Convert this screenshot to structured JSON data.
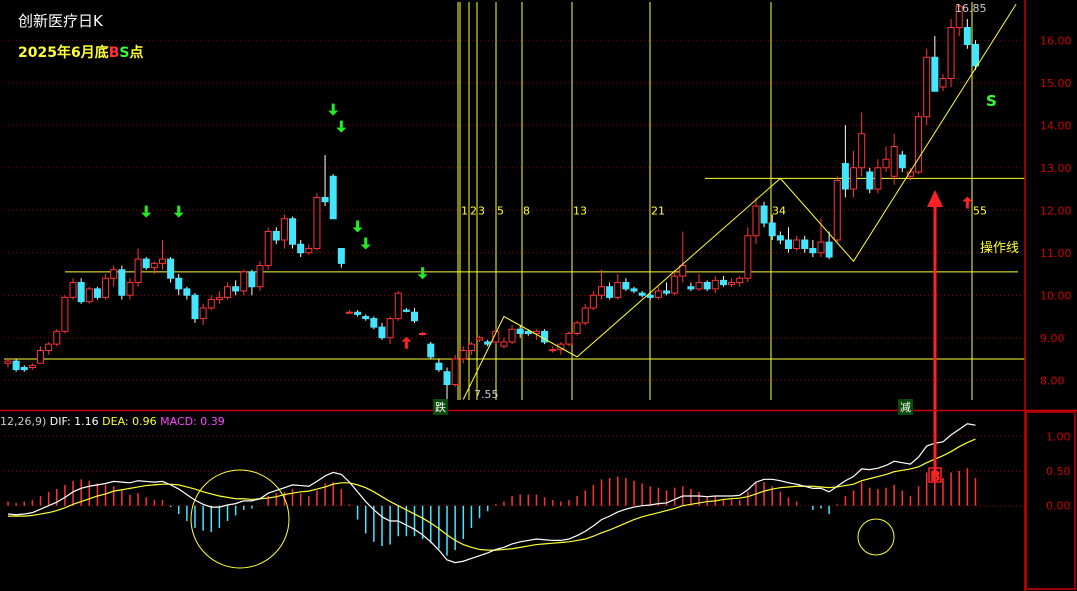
{
  "title": "创新医疗日K",
  "subtitle": {
    "prefix": "2025年6月底",
    "b": "B",
    "s": "S",
    "suffix": "点"
  },
  "macd_header": {
    "params": "12,26,9)",
    "dif": "DIF: 1.16",
    "dea": "DEA: 0.96",
    "macd": "MACD: 0.39"
  },
  "labels": {
    "high": "16.85",
    "low": "7.55",
    "operation_line": "操作线",
    "sell_marker": "S",
    "buy_marker": "B",
    "box_left": "跌",
    "box_right": "减"
  },
  "fib_numbers": [
    "1",
    "2",
    "3",
    "5",
    "8",
    "13",
    "21",
    "34",
    "55"
  ],
  "colors": {
    "up": "#ff3333",
    "down": "#44e6ff",
    "yellow": "#ffff33",
    "grid": "#990000",
    "axis": "#cc0000",
    "arrow_green": "#22ee22",
    "arrow_red": "#ff2222"
  },
  "chart_data": [
    {
      "type": "candlestick",
      "title": "创新医疗日K",
      "ylim": [
        7.3,
        16.9
      ],
      "yticks": [
        8.0,
        9.0,
        10.0,
        11.0,
        12.0,
        13.0,
        14.0,
        15.0,
        16.0
      ],
      "ytick_labels": [
        "8.00",
        "9.00",
        "10.00",
        "11.00",
        "12.00",
        "13.00",
        "14.00",
        "15.00",
        "16.00"
      ],
      "horizontal_lines": [
        8.5,
        10.55,
        12.75
      ],
      "candles": [
        [
          8.4,
          8.5,
          8.3,
          8.45
        ],
        [
          8.45,
          8.5,
          8.2,
          8.25
        ],
        [
          8.3,
          8.35,
          8.2,
          8.25
        ],
        [
          8.3,
          8.4,
          8.25,
          8.35
        ],
        [
          8.4,
          8.8,
          8.4,
          8.7
        ],
        [
          8.7,
          8.9,
          8.6,
          8.85
        ],
        [
          8.85,
          9.2,
          8.8,
          9.15
        ],
        [
          9.15,
          10.0,
          9.1,
          9.95
        ],
        [
          9.95,
          10.4,
          9.9,
          10.3
        ],
        [
          10.3,
          10.4,
          9.8,
          9.85
        ],
        [
          9.85,
          10.2,
          9.8,
          10.15
        ],
        [
          10.15,
          10.2,
          9.9,
          9.95
        ],
        [
          9.95,
          10.5,
          9.9,
          10.4
        ],
        [
          10.4,
          10.7,
          10.2,
          10.6
        ],
        [
          10.6,
          10.7,
          9.9,
          10.0
        ],
        [
          10.0,
          10.4,
          9.9,
          10.3
        ],
        [
          10.3,
          11.1,
          10.2,
          10.85
        ],
        [
          10.85,
          10.9,
          10.6,
          10.65
        ],
        [
          10.65,
          10.8,
          10.5,
          10.75
        ],
        [
          10.75,
          11.3,
          10.6,
          10.85
        ],
        [
          10.85,
          10.9,
          10.3,
          10.4
        ],
        [
          10.4,
          10.5,
          10.0,
          10.15
        ],
        [
          10.15,
          10.2,
          9.9,
          10.0
        ],
        [
          10.0,
          10.05,
          9.35,
          9.45
        ],
        [
          9.45,
          9.8,
          9.3,
          9.7
        ],
        [
          9.7,
          10.0,
          9.65,
          9.9
        ],
        [
          9.9,
          10.1,
          9.8,
          9.95
        ],
        [
          9.95,
          10.3,
          9.9,
          10.2
        ],
        [
          10.2,
          10.35,
          10.0,
          10.1
        ],
        [
          10.1,
          10.6,
          10.0,
          10.55
        ],
        [
          10.55,
          10.6,
          10.0,
          10.2
        ],
        [
          10.2,
          10.8,
          10.1,
          10.7
        ],
        [
          10.7,
          11.6,
          10.6,
          11.5
        ],
        [
          11.5,
          11.6,
          11.2,
          11.3
        ],
        [
          11.3,
          11.9,
          11.1,
          11.8
        ],
        [
          11.8,
          11.85,
          11.1,
          11.2
        ],
        [
          11.2,
          11.3,
          10.9,
          11.0
        ],
        [
          11.0,
          11.2,
          10.95,
          11.1
        ],
        [
          11.1,
          12.4,
          11.05,
          12.3
        ],
        [
          12.3,
          13.3,
          12.1,
          12.2
        ],
        [
          12.8,
          12.85,
          11.9,
          11.8
        ],
        [
          11.1,
          11.1,
          10.65,
          10.75
        ],
        [
          9.6,
          9.65,
          9.6,
          9.6
        ],
        [
          9.6,
          9.65,
          9.5,
          9.55
        ],
        [
          9.5,
          9.55,
          9.4,
          9.45
        ],
        [
          9.45,
          9.5,
          9.2,
          9.25
        ],
        [
          9.25,
          9.35,
          8.95,
          9.0
        ],
        [
          9.0,
          9.5,
          8.85,
          9.45
        ],
        [
          9.45,
          10.1,
          9.4,
          10.05
        ],
        [
          9.65,
          9.7,
          9.6,
          9.62
        ],
        [
          9.6,
          9.7,
          9.35,
          9.4
        ],
        [
          9.1,
          9.15,
          9.05,
          9.1
        ],
        [
          8.85,
          8.9,
          8.5,
          8.55
        ],
        [
          8.4,
          8.5,
          8.2,
          8.25
        ],
        [
          8.2,
          8.3,
          7.55,
          7.9
        ],
        [
          7.9,
          8.6,
          7.85,
          8.5
        ],
        [
          8.5,
          8.8,
          8.4,
          8.7
        ],
        [
          8.7,
          8.9,
          8.6,
          8.85
        ],
        [
          8.95,
          9.05,
          8.9,
          9.0
        ],
        [
          8.9,
          8.95,
          8.8,
          8.85
        ],
        [
          8.9,
          9.2,
          8.85,
          9.15
        ],
        [
          8.8,
          9.0,
          8.75,
          8.9
        ],
        [
          8.9,
          9.3,
          8.85,
          9.2
        ],
        [
          9.2,
          9.3,
          9.0,
          9.1
        ],
        [
          9.15,
          9.2,
          9.05,
          9.1
        ],
        [
          9.1,
          9.2,
          8.95,
          9.15
        ],
        [
          9.15,
          9.2,
          8.85,
          8.9
        ],
        [
          8.7,
          8.8,
          8.65,
          8.72
        ],
        [
          8.72,
          8.9,
          8.6,
          8.85
        ],
        [
          8.85,
          9.15,
          8.8,
          9.1
        ],
        [
          9.1,
          9.4,
          9.05,
          9.35
        ],
        [
          9.35,
          9.8,
          9.3,
          9.7
        ],
        [
          9.7,
          10.1,
          9.65,
          10.0
        ],
        [
          10.0,
          10.6,
          9.9,
          10.2
        ],
        [
          10.2,
          10.3,
          9.9,
          9.95
        ],
        [
          9.95,
          10.5,
          9.9,
          10.3
        ],
        [
          10.3,
          10.4,
          10.1,
          10.15
        ],
        [
          10.15,
          10.2,
          10.05,
          10.1
        ],
        [
          10.05,
          10.1,
          9.95,
          10.0
        ],
        [
          10.0,
          10.05,
          9.9,
          9.95
        ],
        [
          9.95,
          10.2,
          9.9,
          10.1
        ],
        [
          10.1,
          10.3,
          10.0,
          10.05
        ],
        [
          10.05,
          10.6,
          10.0,
          10.45
        ],
        [
          10.45,
          11.5,
          10.3,
          10.7
        ],
        [
          10.2,
          10.3,
          10.1,
          10.15
        ],
        [
          10.15,
          10.5,
          10.1,
          10.3
        ],
        [
          10.3,
          10.35,
          10.1,
          10.15
        ],
        [
          10.15,
          10.45,
          10.05,
          10.35
        ],
        [
          10.35,
          10.45,
          10.2,
          10.25
        ],
        [
          10.25,
          10.4,
          10.2,
          10.3
        ],
        [
          10.3,
          10.45,
          10.2,
          10.4
        ],
        [
          10.4,
          11.6,
          10.3,
          11.4
        ],
        [
          11.4,
          12.3,
          11.2,
          12.1
        ],
        [
          12.1,
          12.2,
          11.6,
          11.7
        ],
        [
          11.7,
          11.9,
          11.3,
          11.4
        ],
        [
          11.4,
          11.5,
          11.2,
          11.3
        ],
        [
          11.3,
          11.6,
          11.0,
          11.1
        ],
        [
          11.1,
          11.4,
          11.05,
          11.3
        ],
        [
          11.3,
          11.4,
          11.0,
          11.1
        ],
        [
          11.1,
          11.3,
          10.9,
          11.0
        ],
        [
          11.0,
          11.8,
          10.9,
          11.25
        ],
        [
          11.25,
          11.5,
          10.85,
          10.9
        ],
        [
          11.3,
          12.8,
          11.25,
          12.7
        ],
        [
          13.1,
          14.0,
          12.3,
          12.5
        ],
        [
          12.5,
          13.4,
          12.3,
          13.0
        ],
        [
          13.0,
          14.3,
          12.8,
          13.8
        ],
        [
          12.9,
          13.0,
          12.4,
          12.5
        ],
        [
          12.5,
          13.2,
          12.4,
          13.0
        ],
        [
          13.0,
          13.5,
          12.9,
          13.2
        ],
        [
          12.8,
          13.8,
          12.6,
          13.5
        ],
        [
          13.3,
          13.4,
          12.9,
          13.0
        ],
        [
          12.8,
          13.0,
          12.7,
          12.9
        ],
        [
          12.9,
          14.3,
          12.85,
          14.2
        ],
        [
          14.2,
          15.8,
          14.0,
          15.6
        ],
        [
          15.6,
          16.1,
          14.8,
          14.8
        ],
        [
          14.9,
          15.2,
          14.8,
          15.1
        ],
        [
          15.1,
          16.5,
          14.9,
          16.3
        ],
        [
          16.3,
          16.85,
          16.1,
          16.8
        ],
        [
          16.3,
          16.5,
          15.8,
          15.9
        ],
        [
          15.9,
          16.0,
          15.3,
          15.4
        ]
      ]
    },
    {
      "type": "line",
      "title": "MACD",
      "ylim": [
        -1.2,
        1.35
      ],
      "yticks": [
        0.0,
        0.5,
        1.0
      ],
      "ytick_labels": [
        "0.00",
        "0.50",
        "1.00"
      ],
      "series": [
        {
          "name": "DIF",
          "values": [
            -0.12,
            -0.13,
            -0.12,
            -0.1,
            -0.05,
            0.0,
            0.05,
            0.12,
            0.2,
            0.25,
            0.28,
            0.3,
            0.32,
            0.35,
            0.34,
            0.33,
            0.36,
            0.35,
            0.34,
            0.35,
            0.3,
            0.24,
            0.16,
            0.08,
            0.02,
            -0.02,
            -0.02,
            0.01,
            0.03,
            0.07,
            0.07,
            0.1,
            0.18,
            0.22,
            0.26,
            0.3,
            0.29,
            0.28,
            0.35,
            0.43,
            0.48,
            0.45,
            0.34,
            0.2,
            0.06,
            -0.06,
            -0.16,
            -0.22,
            -0.22,
            -0.28,
            -0.34,
            -0.42,
            -0.52,
            -0.64,
            -0.78,
            -0.82,
            -0.8,
            -0.76,
            -0.72,
            -0.68,
            -0.63,
            -0.6,
            -0.55,
            -0.52,
            -0.5,
            -0.48,
            -0.49,
            -0.5,
            -0.5,
            -0.48,
            -0.43,
            -0.37,
            -0.29,
            -0.2,
            -0.15,
            -0.09,
            -0.05,
            -0.02,
            0.0,
            0.01,
            0.03,
            0.04,
            0.09,
            0.14,
            0.14,
            0.14,
            0.13,
            0.14,
            0.14,
            0.14,
            0.15,
            0.23,
            0.34,
            0.38,
            0.38,
            0.36,
            0.33,
            0.31,
            0.28,
            0.25,
            0.25,
            0.2,
            0.28,
            0.36,
            0.42,
            0.53,
            0.52,
            0.54,
            0.58,
            0.64,
            0.62,
            0.6,
            0.7,
            0.86,
            0.9,
            0.92,
            1.02,
            1.1,
            1.18,
            1.16
          ]
        },
        {
          "name": "DEA",
          "values": [
            -0.15,
            -0.15,
            -0.15,
            -0.14,
            -0.12,
            -0.1,
            -0.07,
            -0.03,
            0.02,
            0.06,
            0.1,
            0.14,
            0.17,
            0.21,
            0.23,
            0.25,
            0.27,
            0.29,
            0.3,
            0.31,
            0.31,
            0.3,
            0.27,
            0.24,
            0.2,
            0.17,
            0.14,
            0.12,
            0.1,
            0.1,
            0.09,
            0.1,
            0.11,
            0.13,
            0.16,
            0.18,
            0.2,
            0.21,
            0.24,
            0.27,
            0.31,
            0.33,
            0.33,
            0.3,
            0.26,
            0.2,
            0.13,
            0.06,
            0.0,
            -0.06,
            -0.12,
            -0.18,
            -0.25,
            -0.33,
            -0.42,
            -0.5,
            -0.56,
            -0.6,
            -0.63,
            -0.64,
            -0.64,
            -0.63,
            -0.62,
            -0.6,
            -0.58,
            -0.56,
            -0.55,
            -0.54,
            -0.53,
            -0.52,
            -0.5,
            -0.48,
            -0.44,
            -0.39,
            -0.35,
            -0.3,
            -0.25,
            -0.2,
            -0.16,
            -0.13,
            -0.1,
            -0.07,
            -0.04,
            0.0,
            0.02,
            0.04,
            0.06,
            0.07,
            0.09,
            0.1,
            0.11,
            0.13,
            0.17,
            0.21,
            0.24,
            0.26,
            0.27,
            0.28,
            0.28,
            0.28,
            0.27,
            0.26,
            0.27,
            0.29,
            0.31,
            0.36,
            0.39,
            0.42,
            0.45,
            0.49,
            0.51,
            0.53,
            0.56,
            0.62,
            0.67,
            0.72,
            0.78,
            0.85,
            0.91,
            0.96
          ]
        },
        {
          "name": "MACD",
          "type": "bar",
          "values": [
            0.06,
            0.04,
            0.06,
            0.08,
            0.14,
            0.2,
            0.24,
            0.3,
            0.36,
            0.38,
            0.36,
            0.32,
            0.3,
            0.28,
            0.22,
            0.16,
            0.18,
            0.12,
            0.08,
            0.08,
            -0.02,
            -0.12,
            -0.22,
            -0.32,
            -0.36,
            -0.38,
            -0.32,
            -0.22,
            -0.14,
            -0.06,
            -0.04,
            0.0,
            0.14,
            0.18,
            0.2,
            0.24,
            0.18,
            0.14,
            0.22,
            0.32,
            0.34,
            0.24,
            0.02,
            -0.2,
            -0.4,
            -0.52,
            -0.58,
            -0.56,
            -0.44,
            -0.44,
            -0.44,
            -0.48,
            -0.54,
            -0.62,
            -0.72,
            -0.64,
            -0.48,
            -0.32,
            -0.18,
            -0.08,
            0.02,
            0.06,
            0.14,
            0.16,
            0.16,
            0.16,
            0.12,
            0.08,
            0.06,
            0.08,
            0.14,
            0.22,
            0.3,
            0.38,
            0.4,
            0.42,
            0.4,
            0.36,
            0.32,
            0.28,
            0.26,
            0.22,
            0.26,
            0.28,
            0.24,
            0.2,
            0.14,
            0.14,
            0.1,
            0.08,
            0.08,
            0.2,
            0.34,
            0.34,
            0.28,
            0.2,
            0.12,
            0.06,
            0.0,
            -0.06,
            -0.04,
            -0.12,
            0.02,
            0.14,
            0.22,
            0.34,
            0.26,
            0.24,
            0.26,
            0.3,
            0.22,
            0.14,
            0.28,
            0.48,
            0.46,
            0.4,
            0.48,
            0.5,
            0.54,
            0.4
          ]
        }
      ]
    }
  ]
}
